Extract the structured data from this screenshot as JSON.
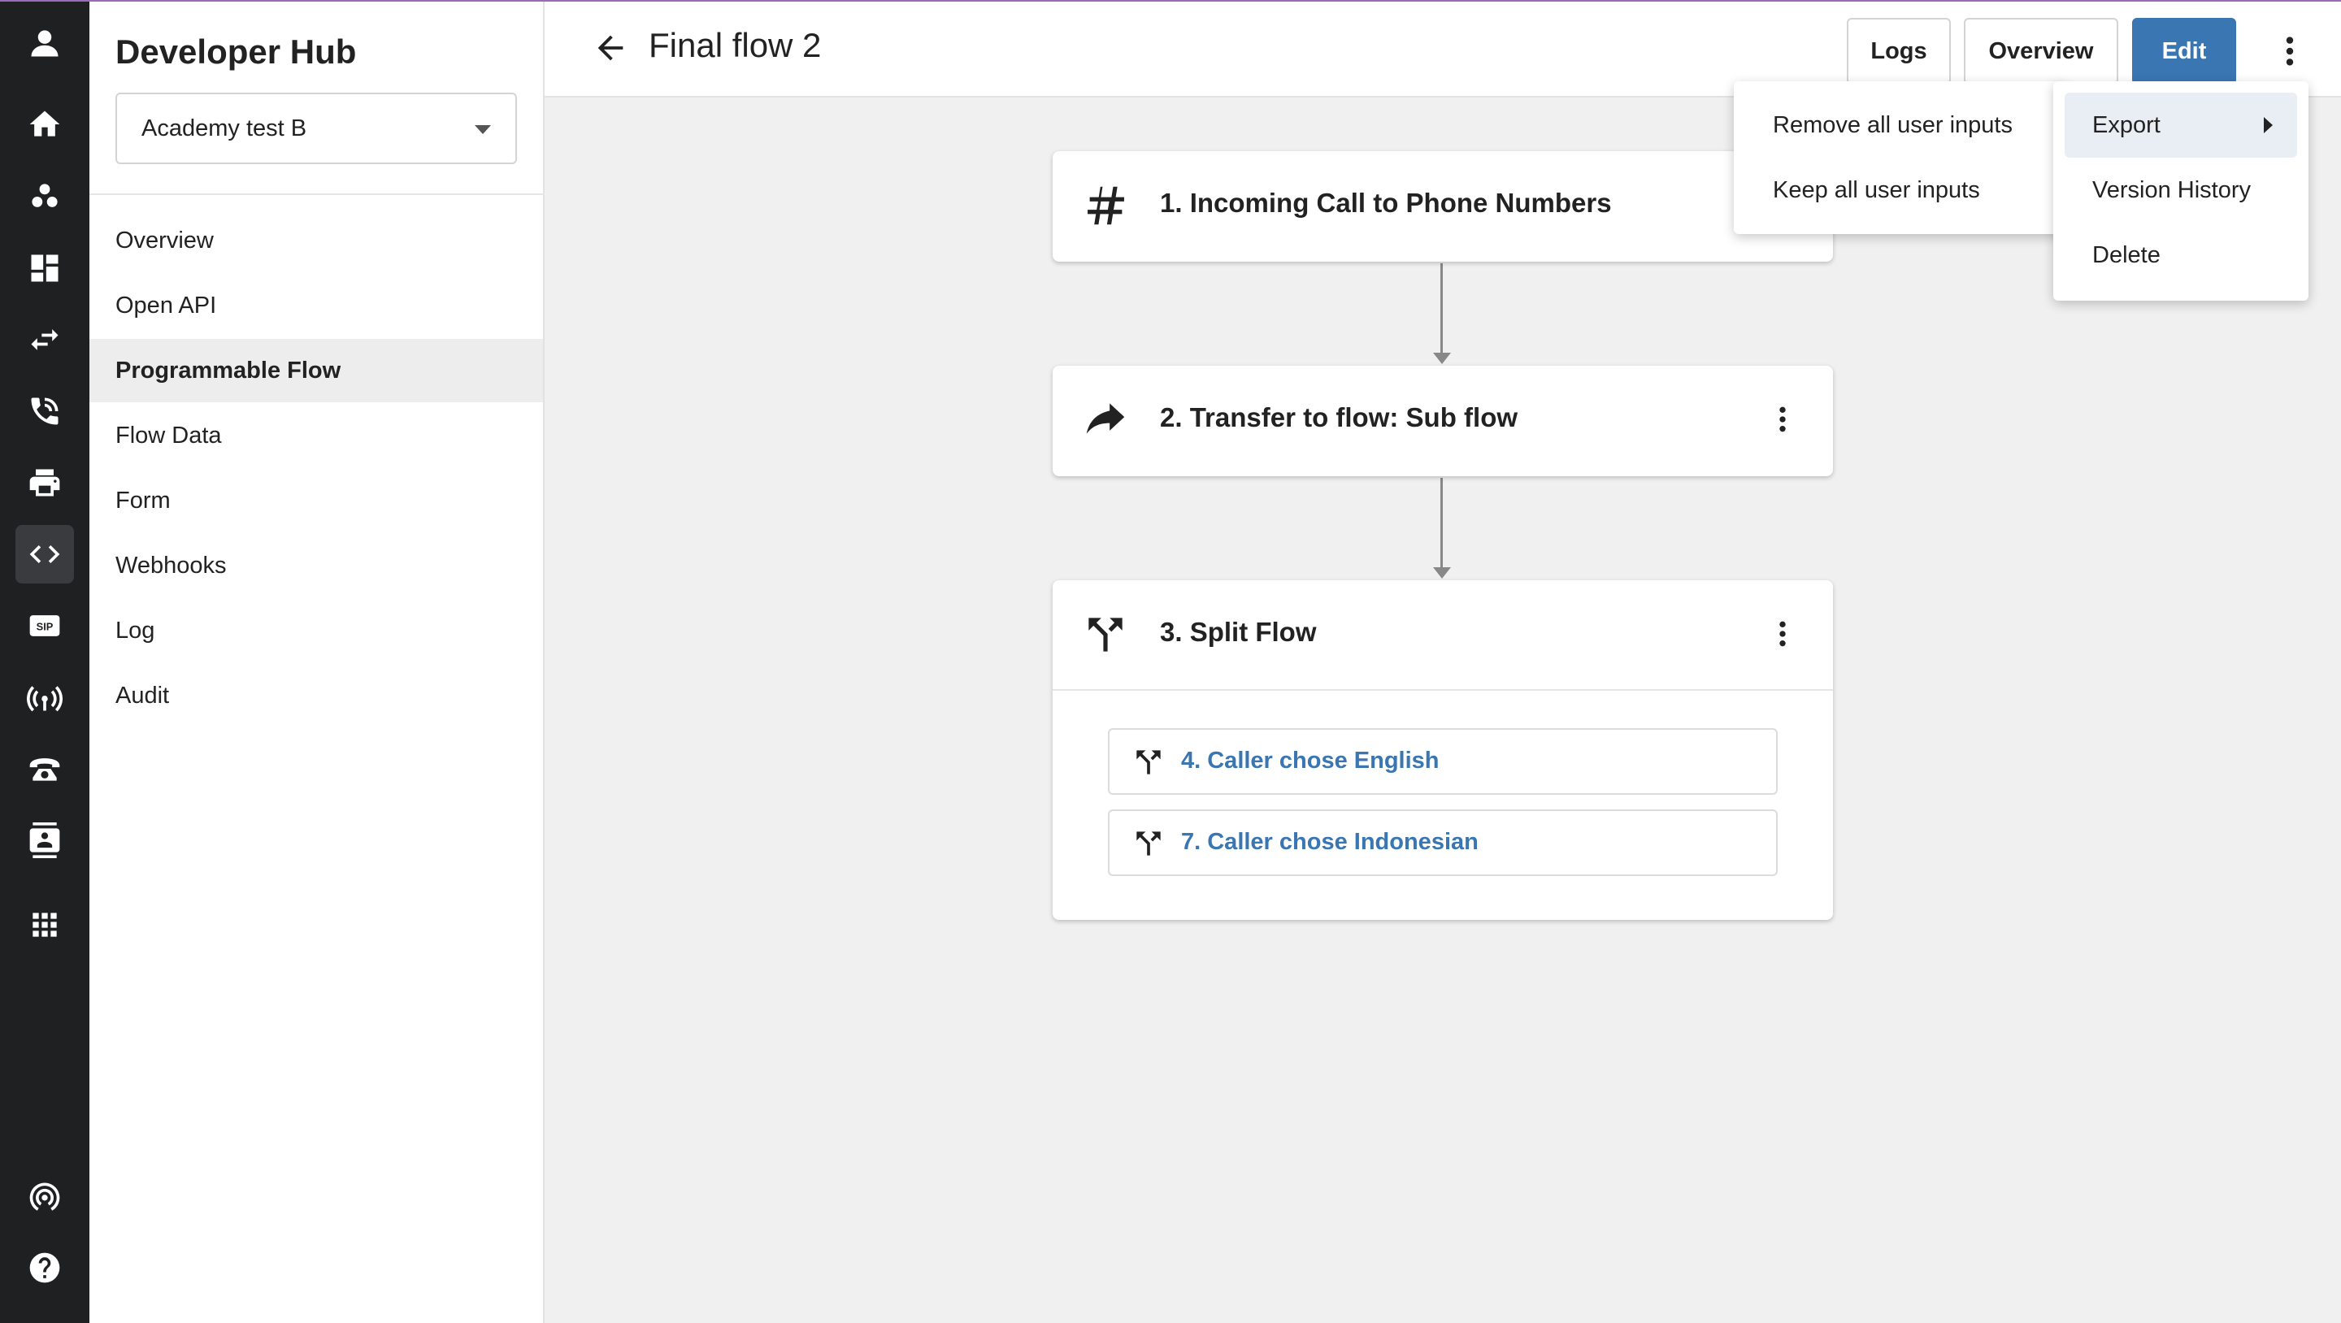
{
  "rail": {
    "items": [
      {
        "icon": "user-avatar-icon"
      },
      {
        "icon": "home-icon"
      },
      {
        "icon": "people-icon"
      },
      {
        "icon": "dashboard-icon"
      },
      {
        "icon": "transfer-icon"
      },
      {
        "icon": "phone-call-icon"
      },
      {
        "icon": "print-icon"
      },
      {
        "icon": "code-icon",
        "active": true
      },
      {
        "icon": "sip-icon"
      },
      {
        "icon": "broadcast-icon"
      },
      {
        "icon": "desk-phone-icon"
      },
      {
        "icon": "contact-card-icon"
      },
      {
        "icon": "apps-grid-icon"
      },
      {
        "icon": "podcast-icon"
      },
      {
        "icon": "help-icon"
      }
    ],
    "sip_text": "SIP"
  },
  "sidebar": {
    "title": "Developer Hub",
    "account_select": {
      "value": "Academy test B"
    },
    "items": [
      {
        "label": "Overview"
      },
      {
        "label": "Open API"
      },
      {
        "label": "Programmable Flow",
        "active": true
      },
      {
        "label": "Flow Data"
      },
      {
        "label": "Form"
      },
      {
        "label": "Webhooks"
      },
      {
        "label": "Log"
      },
      {
        "label": "Audit"
      }
    ]
  },
  "header": {
    "title": "Final flow 2",
    "logs_label": "Logs",
    "overview_label": "Overview",
    "edit_label": "Edit"
  },
  "flow": {
    "nodes": [
      {
        "title": "1. Incoming Call to Phone Numbers",
        "icon": "hash-icon"
      },
      {
        "title": "2. Transfer to flow: Sub flow",
        "icon": "forward-arrow-icon"
      },
      {
        "title": "3. Split Flow",
        "icon": "split-icon",
        "branches": [
          {
            "label": "4. Caller chose English"
          },
          {
            "label": "7. Caller chose Indonesian"
          }
        ]
      }
    ]
  },
  "menu": {
    "items": [
      {
        "label": "Export",
        "has_submenu": true,
        "highlighted": true
      },
      {
        "label": "Version History"
      },
      {
        "label": "Delete"
      }
    ],
    "submenu": {
      "items": [
        {
          "label": "Remove all user inputs"
        },
        {
          "label": "Keep all user inputs"
        }
      ]
    }
  },
  "colors": {
    "accent": "#3a76b2",
    "rail_bg": "#1f2022",
    "canvas_bg": "#f0f0f0",
    "top_line": "#9b6bb8"
  }
}
